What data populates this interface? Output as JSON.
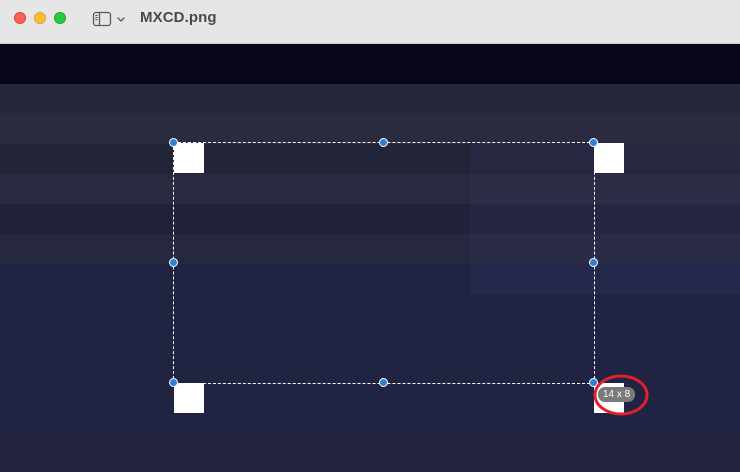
{
  "window": {
    "title": "MXCD.png"
  },
  "toolbar": {
    "sidebar_toggle_icon": "sidebar-toggle-icon",
    "sidebar_menu_icon": "chevron-down-icon"
  },
  "colors": {
    "close": "#fe5f57",
    "minimize": "#febc2e",
    "maximize": "#28c840",
    "selection_handle": "#2f7fd6",
    "annotation": "#e0202a"
  },
  "selection": {
    "size_readout": "14 x 8"
  }
}
